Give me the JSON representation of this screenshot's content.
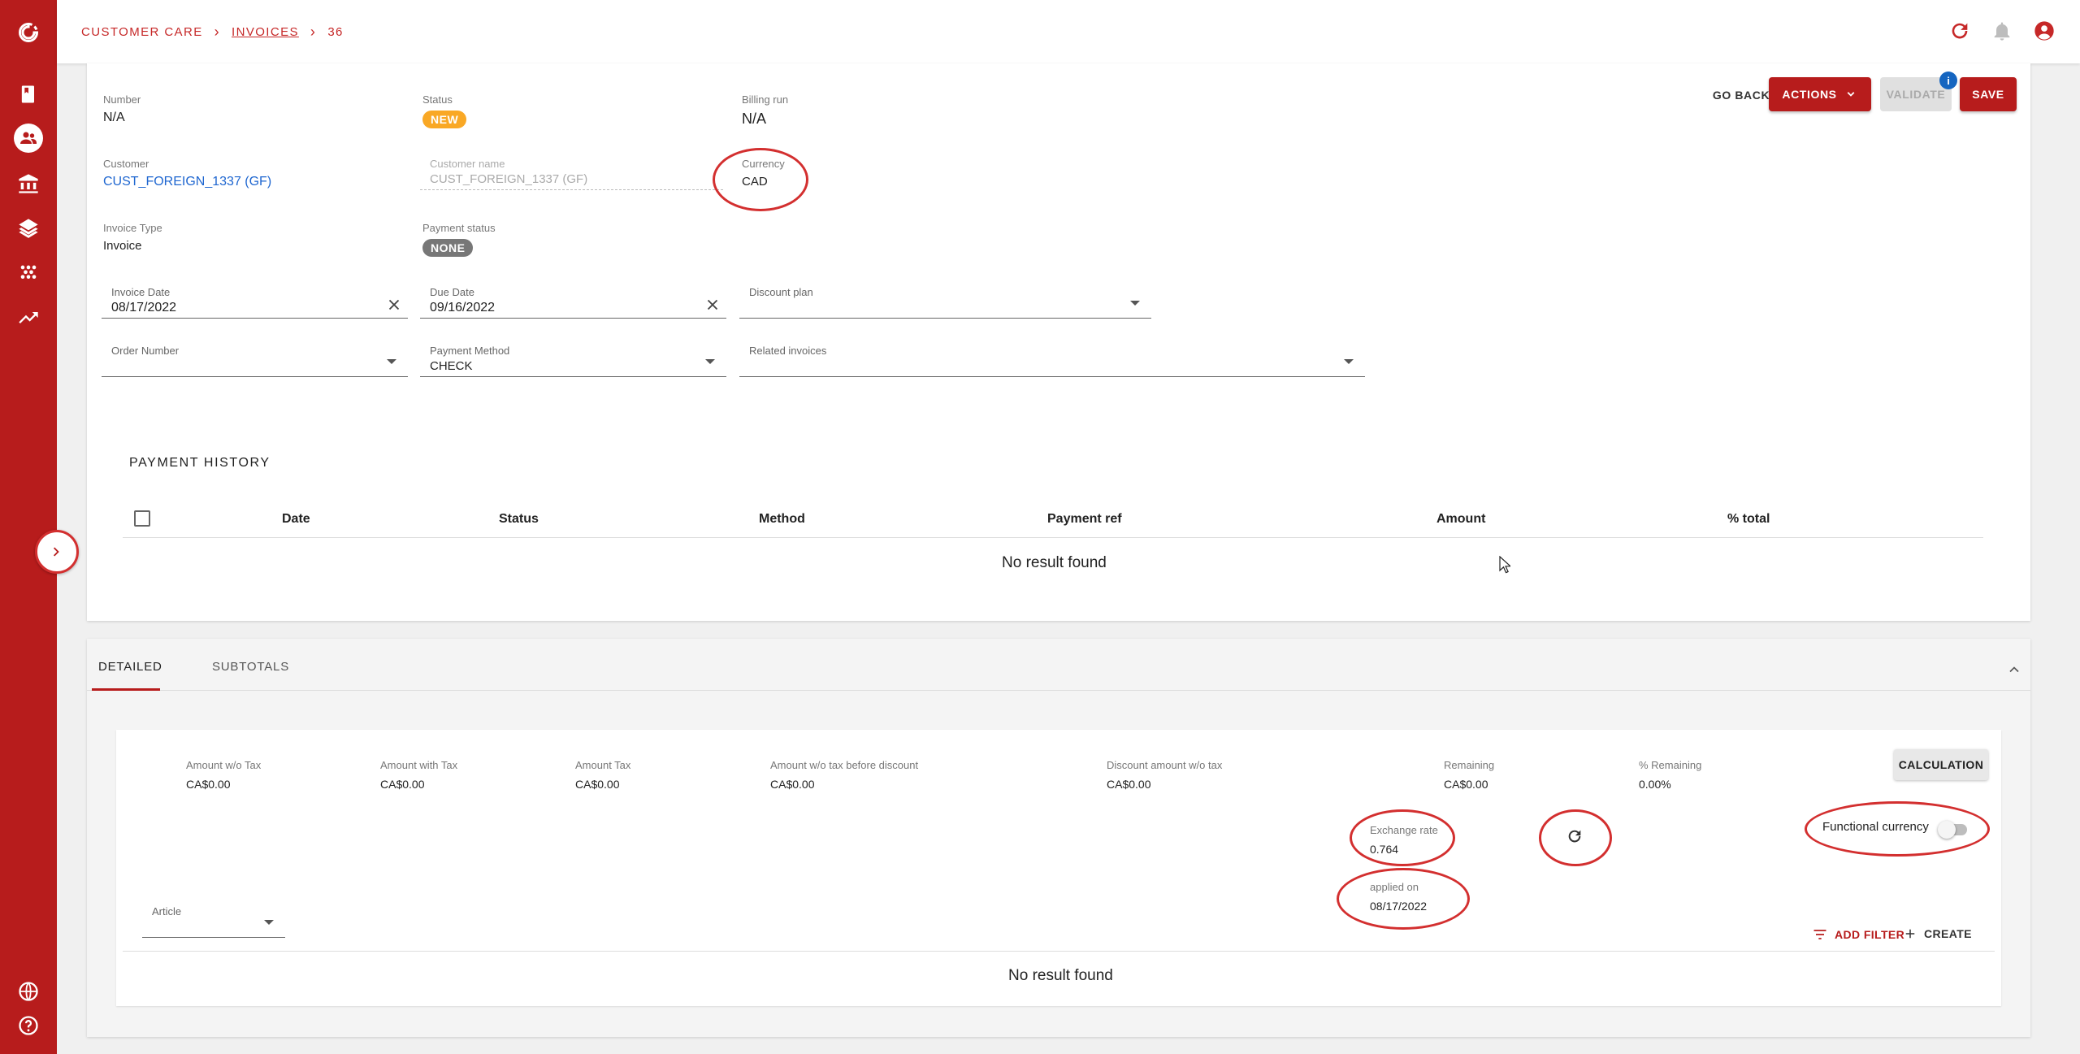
{
  "breadcrumb": [
    "CUSTOMER CARE",
    "INVOICES",
    "36"
  ],
  "toolbar": {
    "go_back": "GO BACK",
    "actions": "ACTIONS",
    "validate": "VALIDATE",
    "validate_badge": "i",
    "save": "SAVE"
  },
  "invoice": {
    "number": {
      "label": "Number",
      "value": "N/A"
    },
    "status": {
      "label": "Status",
      "value": "NEW"
    },
    "billing_run": {
      "label": "Billing run",
      "value": "N/A"
    },
    "customer": {
      "label": "Customer",
      "value": "CUST_FOREIGN_1337 (GF)"
    },
    "customer_name": {
      "label": "Customer name",
      "value": "CUST_FOREIGN_1337 (GF)"
    },
    "currency": {
      "label": "Currency",
      "value": "CAD"
    },
    "invoice_type": {
      "label": "Invoice Type",
      "value": "Invoice"
    },
    "payment_status": {
      "label": "Payment status",
      "value": "NONE"
    },
    "invoice_date": {
      "label": "Invoice Date",
      "value": "08/17/2022"
    },
    "due_date": {
      "label": "Due Date",
      "value": "09/16/2022"
    },
    "discount_plan": {
      "label": "Discount plan",
      "value": ""
    },
    "order_number": {
      "label": "Order Number",
      "value": ""
    },
    "payment_method": {
      "label": "Payment Method",
      "value": "CHECK"
    },
    "related_invoices": {
      "label": "Related invoices",
      "value": ""
    }
  },
  "payment_history": {
    "title": "PAYMENT HISTORY",
    "columns": [
      "Date",
      "Status",
      "Method",
      "Payment ref",
      "Amount",
      "% total"
    ],
    "empty": "No result found"
  },
  "tabs": [
    "DETAILED",
    "SUBTOTALS"
  ],
  "summary": {
    "amount_wo_tax": {
      "label": "Amount w/o Tax",
      "value": "CA$0.00"
    },
    "amount_with_tax": {
      "label": "Amount with Tax",
      "value": "CA$0.00"
    },
    "amount_tax": {
      "label": "Amount Tax",
      "value": "CA$0.00"
    },
    "amount_before_discount": {
      "label": "Amount w/o tax before discount",
      "value": "CA$0.00"
    },
    "discount_amount": {
      "label": "Discount amount w/o tax",
      "value": "CA$0.00"
    },
    "remaining": {
      "label": "Remaining",
      "value": "CA$0.00"
    },
    "pct_remaining": {
      "label": "% Remaining",
      "value": "0.00%"
    },
    "calculation": "CALCULATION",
    "exchange_rate": {
      "label": "Exchange rate",
      "value": "0.764"
    },
    "applied_on": {
      "label": "applied on",
      "value": "08/17/2022"
    },
    "functional_currency": {
      "label": "Functional currency",
      "enabled": false
    }
  },
  "lines": {
    "article_label": "Article",
    "add_filter": "ADD FILTER",
    "create": "CREATE",
    "empty": "No result found"
  }
}
